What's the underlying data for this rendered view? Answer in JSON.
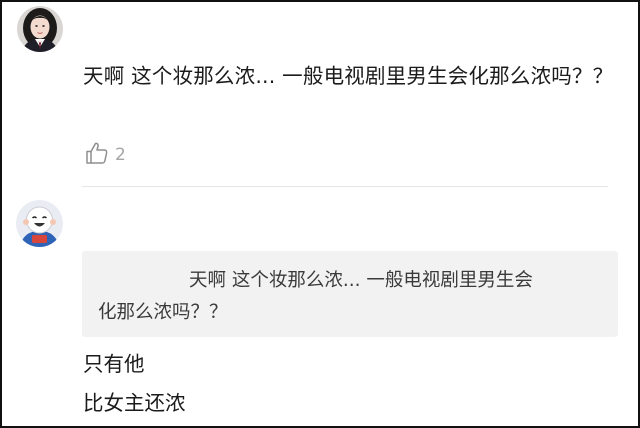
{
  "comments": [
    {
      "avatar_icon": "user-avatar-girl-icon",
      "text": "天啊 这个妆那么浓... 一般电视剧里男生会化那么浓吗？？",
      "like_icon": "thumbs-up-icon",
      "likes": "2"
    },
    {
      "avatar_icon": "user-avatar-cartoon-icon",
      "quote": {
        "line1": "天啊 这个妆那么浓... 一般电视剧里男生会",
        "line2": "化那么浓吗？？"
      },
      "reply": {
        "line1": "只有他",
        "line2": "比女主还浓"
      }
    }
  ],
  "colors": {
    "text": "#1b1b1b",
    "muted": "#a5a5a5",
    "quote_bg": "#f2f2f2",
    "divider": "#e6e6e6",
    "border": "#111111"
  }
}
